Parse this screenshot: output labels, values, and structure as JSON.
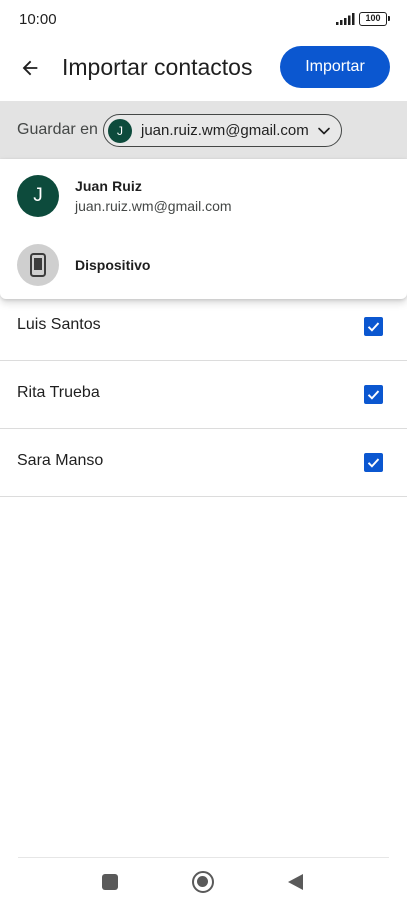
{
  "status_bar": {
    "time": "10:00",
    "battery": "100"
  },
  "header": {
    "title": "Importar contactos",
    "import_label": "Importar"
  },
  "save_in": {
    "label": "Guardar en",
    "account_initial": "J",
    "account_email": "juan.ruiz.wm@gmail.com"
  },
  "menu": {
    "items": [
      {
        "initial": "J",
        "name": "Juan Ruiz",
        "email": "juan.ruiz.wm@gmail.com"
      },
      {
        "name": "Dispositivo"
      }
    ]
  },
  "contacts": [
    {
      "name": "Luis Santos",
      "checked": true
    },
    {
      "name": "Rita Trueba",
      "checked": true
    },
    {
      "name": "Sara Manso",
      "checked": true
    }
  ],
  "colors": {
    "accent": "#0b57d0",
    "avatar": "#0d4b3c",
    "save_bar": "#e3e3e3"
  },
  "icons": {
    "back": "arrow-left-icon",
    "chevron": "chevron-down-icon",
    "device": "smartphone-icon",
    "check": "check-icon"
  }
}
